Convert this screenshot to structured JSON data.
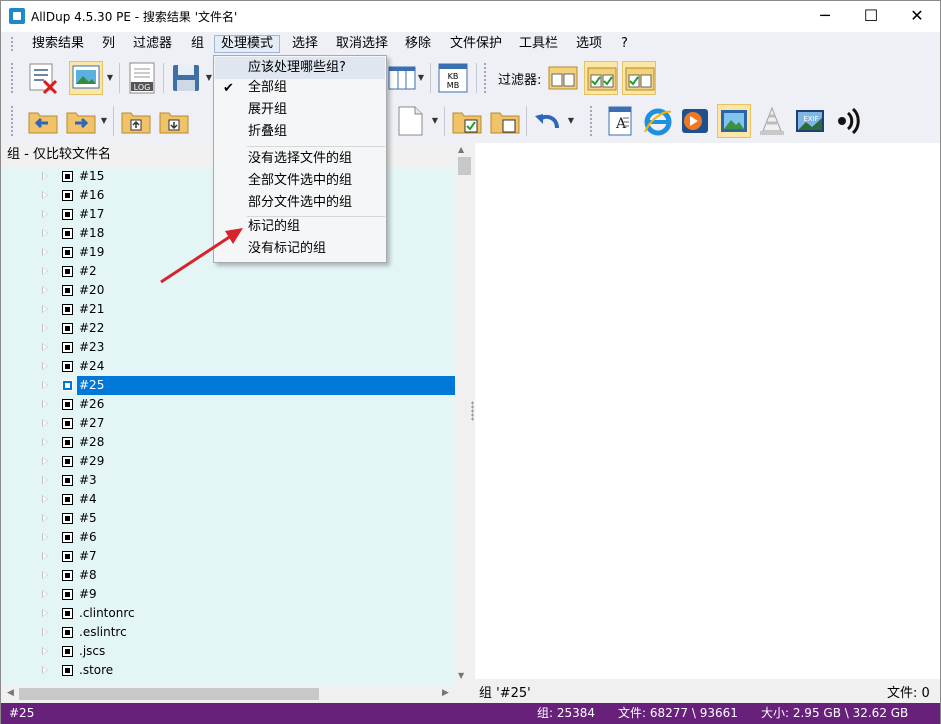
{
  "window": {
    "title": "AllDup 4.5.30 PE - 搜索结果 '文件名'",
    "minimize_glyph": "─",
    "maximize_glyph": "☐",
    "close_glyph": "✕"
  },
  "menu": [
    {
      "label": "搜索结果"
    },
    {
      "label": "列"
    },
    {
      "label": "过滤器"
    },
    {
      "label": "组"
    },
    {
      "label": "处理模式"
    },
    {
      "label": "选择"
    },
    {
      "label": "取消选择"
    },
    {
      "label": "移除"
    },
    {
      "label": "文件保护"
    },
    {
      "label": "工具栏"
    },
    {
      "label": "选项"
    },
    {
      "label": "?"
    }
  ],
  "toolbar": {
    "filter_label": "过滤器:",
    "kbmb_icon_text": "KB\nMB",
    "log_icon_text": "LOG",
    "exif_icon_text": "EXIF"
  },
  "dropdown": {
    "header": "应该处理哪些组?",
    "items": [
      {
        "label": "全部组",
        "checked": true
      },
      {
        "label": "展开组",
        "checked": false
      },
      {
        "label": "折叠组",
        "checked": false
      },
      {
        "label": "没有选择文件的组",
        "checked": false
      },
      {
        "label": "全部文件选中的组",
        "checked": false
      },
      {
        "label": "部分文件选中的组",
        "checked": false
      },
      {
        "label": "标记的组",
        "checked": false
      },
      {
        "label": "没有标记的组",
        "checked": false
      }
    ]
  },
  "left_panel": {
    "header": "组 - 仅比较文件名",
    "rows": [
      {
        "label": "#15"
      },
      {
        "label": "#16"
      },
      {
        "label": "#17"
      },
      {
        "label": "#18"
      },
      {
        "label": "#19"
      },
      {
        "label": "#2"
      },
      {
        "label": "#20"
      },
      {
        "label": "#21"
      },
      {
        "label": "#22"
      },
      {
        "label": "#23"
      },
      {
        "label": "#24"
      },
      {
        "label": "#25",
        "selected": true
      },
      {
        "label": "#26"
      },
      {
        "label": "#27"
      },
      {
        "label": "#28"
      },
      {
        "label": "#29"
      },
      {
        "label": "#3"
      },
      {
        "label": "#4"
      },
      {
        "label": "#5"
      },
      {
        "label": "#6"
      },
      {
        "label": "#7"
      },
      {
        "label": "#8"
      },
      {
        "label": "#9"
      },
      {
        "label": ".clintonrc"
      },
      {
        "label": ".eslintrc"
      },
      {
        "label": ".jscs"
      },
      {
        "label": ".store"
      }
    ]
  },
  "right_panel": {
    "footer_group": "组 '#25'",
    "footer_files": "文件: 0"
  },
  "statusbar": {
    "left": "#25",
    "groups": "组: 25384",
    "files": "文件: 68277 \\ 93661",
    "size": "大小: 2.95 GB \\ 32.62 GB"
  },
  "colors": {
    "accent": "#0078d7",
    "status_bg": "#68217a",
    "tree_bg": "#e4f5f5",
    "arrow": "#d9232b"
  }
}
